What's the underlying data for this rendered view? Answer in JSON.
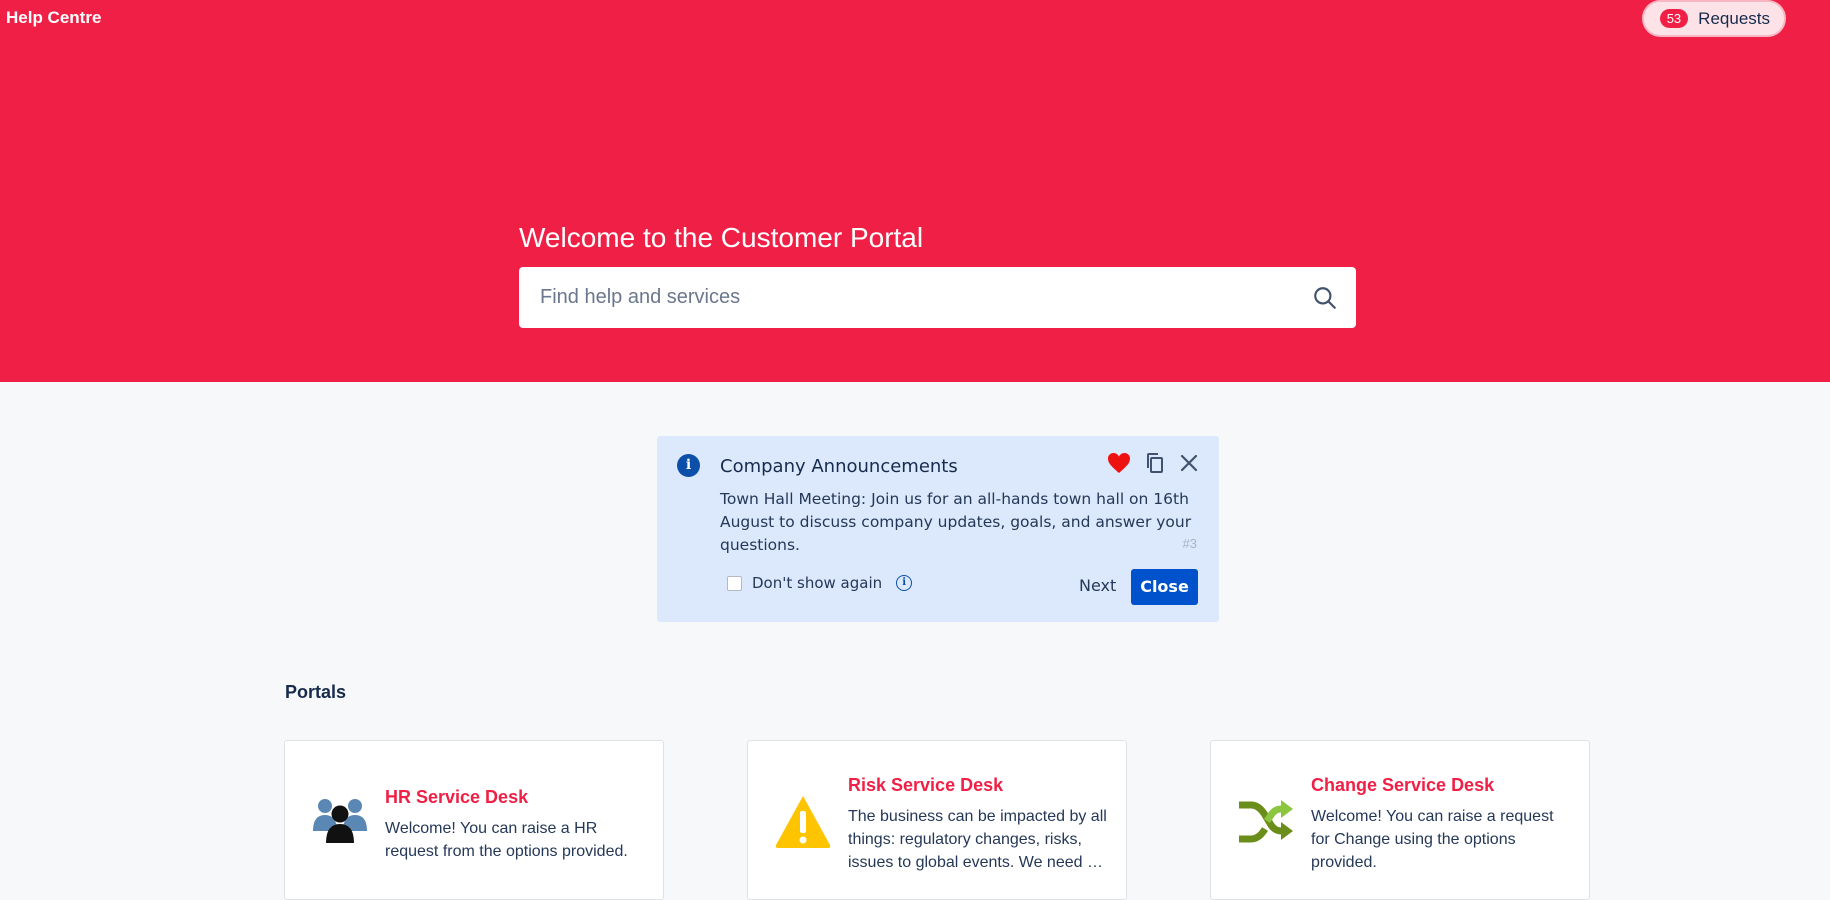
{
  "header": {
    "brand": "Help Centre",
    "requests_count": "53",
    "requests_label": "Requests"
  },
  "hero": {
    "title": "Welcome to the Customer Portal",
    "search_placeholder": "Find help and services",
    "search_value": ""
  },
  "announcement": {
    "title": "Company Announcements",
    "body": "Town Hall Meeting: Join us for an all-hands town hall on 16th August to discuss company updates, goals, and answer your questions.",
    "number": "#3",
    "dont_show_label": "Don't show again",
    "next_label": "Next",
    "close_label": "Close",
    "info_glyph": "i"
  },
  "portals": {
    "heading": "Portals",
    "items": [
      {
        "title": "HR Service Desk",
        "description": "Welcome! You can raise a HR request from the options provided.",
        "icon": "people-group-icon"
      },
      {
        "title": "Risk Service Desk",
        "description": "The business can be impacted by all things: regulatory changes, risks, issues to global events. We need …",
        "icon": "warning-triangle-icon"
      },
      {
        "title": "Change Service Desk",
        "description": "Welcome! You can raise a request for Change using the options provided.",
        "icon": "shuffle-arrows-icon"
      }
    ]
  },
  "colors": {
    "brand": "#f01f46",
    "primary_button": "#0052cc",
    "announcement_bg": "#dce8fb",
    "heart": "#ee1111"
  }
}
